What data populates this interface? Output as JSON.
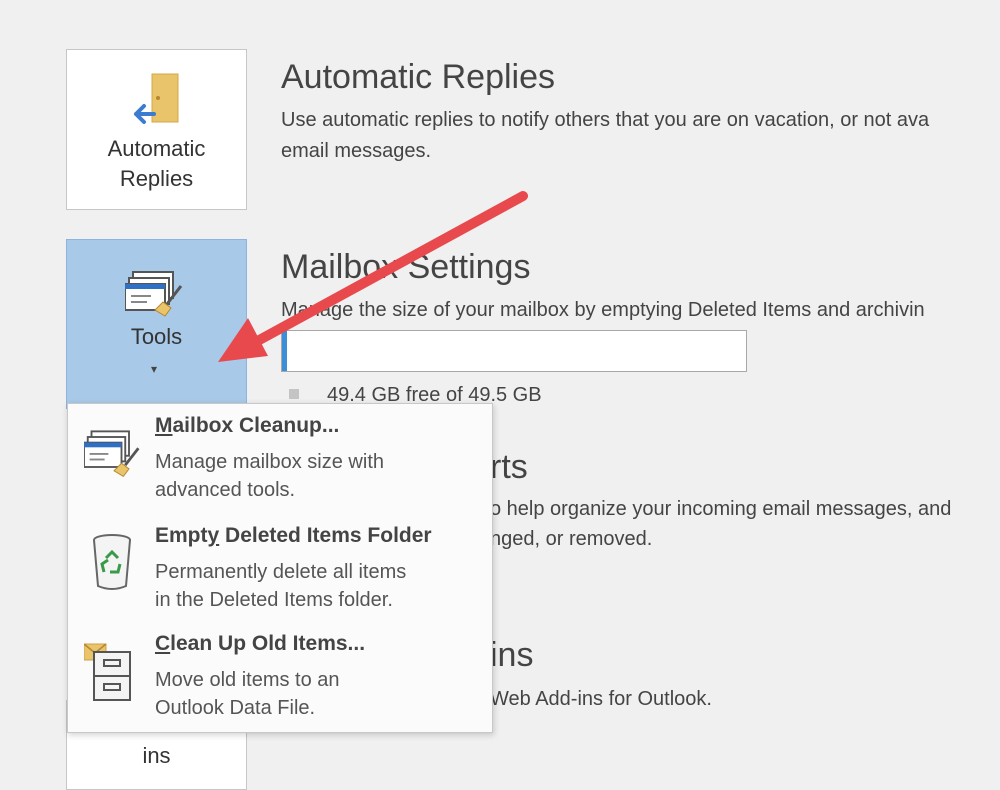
{
  "automatic_replies": {
    "tile_label": "Automatic\nReplies",
    "title": "Automatic Replies",
    "desc_line1": "Use automatic replies to notify others that you are on vacation, or not ava",
    "desc_line2": "email messages."
  },
  "tools": {
    "tile_label": "Tools",
    "caret": "▾"
  },
  "mailbox_settings": {
    "title": "Mailbox Settings",
    "desc": "Manage the size of your mailbox by emptying Deleted Items and archivin",
    "usage_fraction": 0.01,
    "free_text": "49.4 GB free of 49.5 GB"
  },
  "rules": {
    "title_fragment": "rts",
    "desc_line1": "o help organize your incoming email messages, and",
    "desc_line2": "nged, or removed."
  },
  "addins": {
    "title_fragment": "ins",
    "desc": "Web Add-ins for Outlook.",
    "tile_label": "ins"
  },
  "tools_menu": {
    "items": [
      {
        "title_ul": "M",
        "title_rest": "ailbox Cleanup...",
        "desc": "Manage mailbox size with\nadvanced tools.",
        "icon": "mailbox-cleanup-icon"
      },
      {
        "title_pre": "Empt",
        "title_ul": "y",
        "title_rest": " Deleted Items Folder",
        "desc": "Permanently delete all items\nin the Deleted Items folder.",
        "icon": "recycle-bin-icon"
      },
      {
        "title_ul": "C",
        "title_rest": "lean Up Old Items...",
        "desc": "Move old items to an\nOutlook Data File.",
        "icon": "archive-cabinet-icon"
      }
    ]
  },
  "colors": {
    "tools_tile_bg": "#a9c9e8",
    "arrow": "#e8494c",
    "progress_fill": "#3c8fd6"
  }
}
